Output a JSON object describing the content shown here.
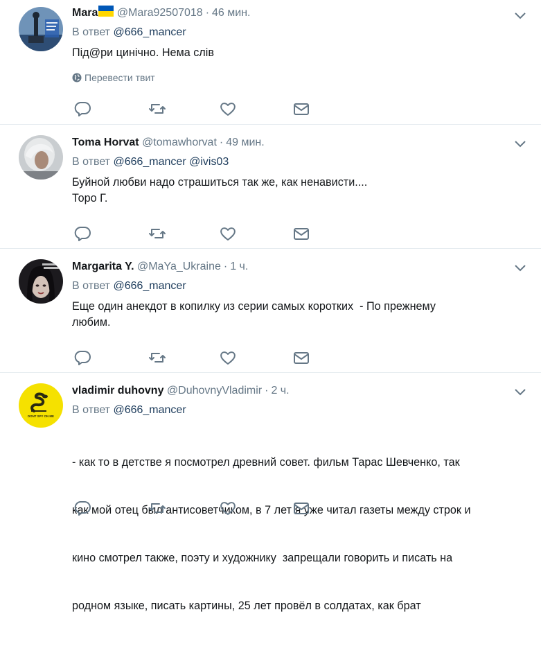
{
  "tweets": [
    {
      "name": "Mara",
      "handle": "@Mara92507018",
      "time": "46 мин.",
      "reply_prefix": "В ответ",
      "reply_to": [
        "@666_mancer"
      ],
      "text": [
        "Під@ри цинічно. Нема слів"
      ],
      "translate": "Перевести твит",
      "avatar_icon": "statue-avatar-icon"
    },
    {
      "name": "Toma Horvat",
      "handle": "@tomawhorvat",
      "time": "49 мин.",
      "reply_prefix": "В ответ",
      "reply_to": [
        "@666_mancer",
        "@ivis03"
      ],
      "text": [
        "Буйной любви надо страшиться так же, как ненависти....",
        "Торо Г."
      ],
      "avatar_icon": "person-avatar-icon"
    },
    {
      "name": "Margarita Y.",
      "handle": "@MaYa_Ukraine",
      "time": "1 ч.",
      "reply_prefix": "В ответ",
      "reply_to": [
        "@666_mancer"
      ],
      "text": [
        "Еще один анекдот в копилку из серии самых коротких  - По прежнему",
        "любим."
      ],
      "avatar_icon": "woman-avatar-icon"
    },
    {
      "name": "vladimir duhovny",
      "handle": "@DuhovnyVladimir",
      "time": "2 ч.",
      "reply_prefix": "В ответ",
      "reply_to": [
        "@666_mancer"
      ],
      "text": [
        "- как то в детстве я посмотрел древний совет. фильм Тарас Шевченко, так",
        "как мой отец был антисоветчиком, в 7 лет я уже читал газеты между строк и",
        "кино смотрел также, поэту и художнику  запрещали говорить и писать на",
        "родном языке, писать картины, 25 лет провёл в солдатах, как брат"
      ],
      "avatar_icon": "snake-flag-avatar-icon",
      "avatar_text": "DONT SPY ON ME"
    }
  ],
  "colors": {
    "text": "#14171a",
    "muted": "#657786",
    "mention": "#1b3a5a",
    "divider": "#e6ecf0",
    "flag_blue": "#0057b7",
    "flag_yellow": "#ffd700",
    "avatar_yellow": "#f5e100"
  },
  "icons": [
    "reply-icon",
    "retweet-icon",
    "like-icon",
    "direct-message-icon",
    "chevron-down-icon",
    "globe-icon"
  ]
}
